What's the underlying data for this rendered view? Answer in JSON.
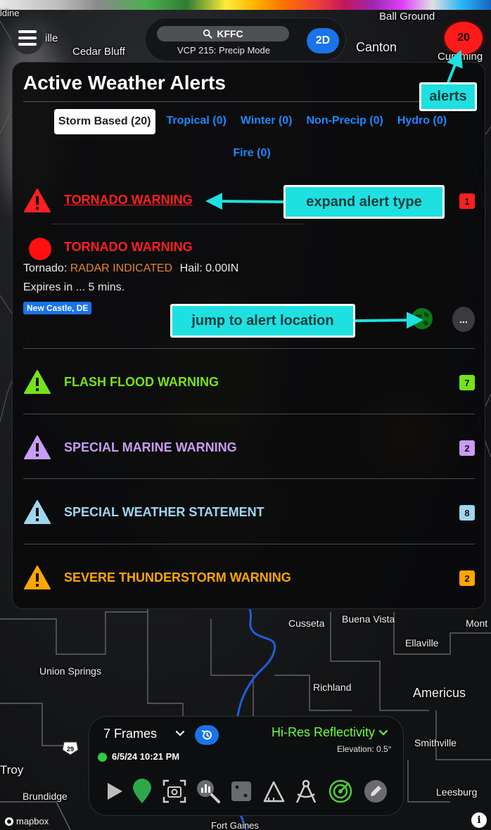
{
  "top_bar": {
    "station": "KFFC",
    "vcp": "VCP 215: Precip Mode",
    "view_mode": "2D",
    "alert_count": "20"
  },
  "map": {
    "labels": [
      "ldine",
      "ille",
      "Cedar Bluff",
      "Ball Ground",
      "Canton",
      "Cumming",
      "Cusseta",
      "Buena Vista",
      "Mont",
      "Ellaville",
      "Union Springs",
      "Richland",
      "Americus",
      "Smithville",
      "Troy",
      "Brundidge",
      "Leesburg",
      "Fort Gaines",
      "29"
    ],
    "attribution": "mapbox"
  },
  "alerts_panel": {
    "title": "Active Weather Alerts",
    "tabs": [
      {
        "label": "Storm Based (20)",
        "active": true
      },
      {
        "label": "Tropical (0)"
      },
      {
        "label": "Winter (0)"
      },
      {
        "label": "Non-Precip (0)"
      },
      {
        "label": "Hydro (0)"
      },
      {
        "label": "Fire (0)"
      }
    ],
    "groups": [
      {
        "name": "TORNADO WARNING",
        "count": "1",
        "color": "#ff1f1f"
      },
      {
        "name": "FLASH FLOOD WARNING",
        "count": "7",
        "color": "#76e21b"
      },
      {
        "name": "SPECIAL MARINE WARNING",
        "count": "2",
        "color": "#c99cf5"
      },
      {
        "name": "SPECIAL WEATHER STATEMENT",
        "count": "8",
        "color": "#9fd6ee"
      },
      {
        "name": "SEVERE THUNDERSTORM WARNING",
        "count": "2",
        "color": "#ffa600"
      }
    ],
    "expanded_alert": {
      "title": "TORNADO WARNING",
      "tornado_label": "Tornado:",
      "tornado_value": "RADAR INDICATED",
      "hail_label": "Hail:",
      "hail_value": "0.00IN",
      "expires": "Expires in ... 5 mins.",
      "location": "New Castle, DE",
      "more_label": "..."
    }
  },
  "callouts": {
    "alerts": "alerts",
    "expand": "expand alert type",
    "jump": "jump to alert location"
  },
  "controls": {
    "frames": "7 Frames",
    "product": "Hi-Res Reflectivity",
    "elevation": "Elevation: 0.5°",
    "timestamp": "6/5/24 10:21 PM",
    "tools": [
      "play-icon",
      "location-pin-icon",
      "screenshot-icon",
      "inspect-icon",
      "dice-icon",
      "triangle-measure-icon",
      "compass-draw-icon",
      "radar-icon",
      "edit-icon"
    ]
  },
  "colors": {
    "accent_blue": "#1a73e8",
    "tab_link": "#1e88ff",
    "product_green": "#6cff3a",
    "callout_cyan": "#1fe0e0",
    "alert_red": "#ff1a1a"
  }
}
